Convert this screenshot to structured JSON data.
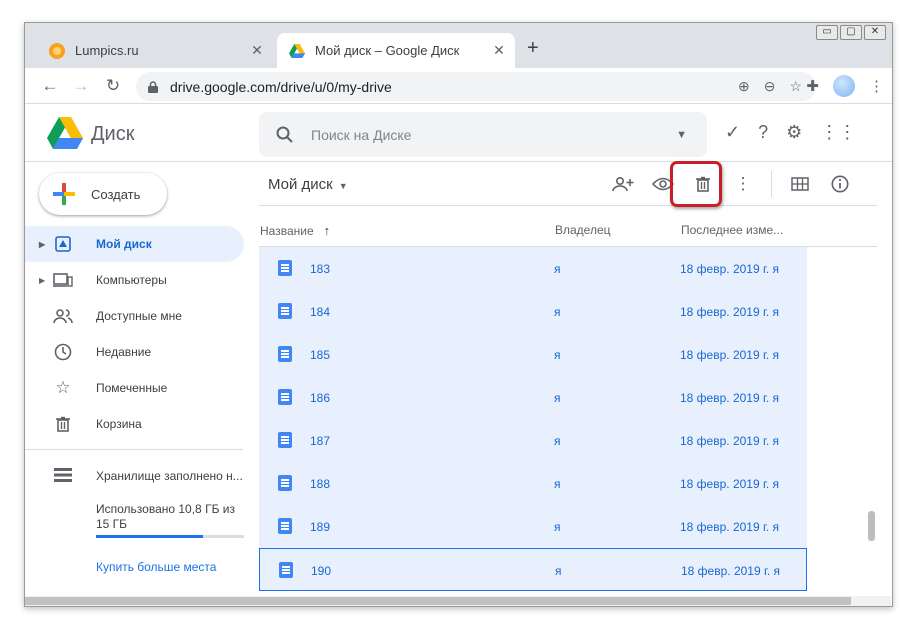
{
  "browser": {
    "tabs": [
      {
        "title": "Lumpics.ru",
        "close": "✕"
      },
      {
        "title": "Мой диск – Google Диск",
        "close": "✕"
      }
    ],
    "new_tab": "+",
    "url": "drive.google.com/drive/u/0/my-drive",
    "window_controls": [
      "▭",
      "▢",
      "✕"
    ]
  },
  "app": {
    "name": "Диск",
    "search_placeholder": "Поиск на Диске"
  },
  "sidebar": {
    "create_label": "Создать",
    "items": [
      {
        "label": "Мой диск",
        "icon": "my-drive-icon",
        "active": true
      },
      {
        "label": "Компьютеры",
        "icon": "computers-icon"
      },
      {
        "label": "Доступные мне",
        "icon": "shared-icon"
      },
      {
        "label": "Недавние",
        "icon": "recent-icon"
      },
      {
        "label": "Помеченные",
        "icon": "starred-icon"
      },
      {
        "label": "Корзина",
        "icon": "trash-icon"
      }
    ],
    "storage": {
      "title": "Хранилище заполнено н...",
      "used": "Использовано 10,8 ГБ из 15 ГБ",
      "fraction": 0.72,
      "buy": "Купить больше места"
    }
  },
  "main": {
    "breadcrumb": "Мой диск",
    "columns": {
      "name": "Название",
      "owner": "Владелец",
      "modified": "Последнее изме..."
    },
    "rows": [
      {
        "name": "183",
        "owner": "я",
        "date": "18 февр. 2019 г. я"
      },
      {
        "name": "184",
        "owner": "я",
        "date": "18 февр. 2019 г. я"
      },
      {
        "name": "185",
        "owner": "я",
        "date": "18 февр. 2019 г. я"
      },
      {
        "name": "186",
        "owner": "я",
        "date": "18 февр. 2019 г. я"
      },
      {
        "name": "187",
        "owner": "я",
        "date": "18 февр. 2019 г. я"
      },
      {
        "name": "188",
        "owner": "я",
        "date": "18 февр. 2019 г. я"
      },
      {
        "name": "189",
        "owner": "я",
        "date": "18 февр. 2019 г. я"
      },
      {
        "name": "190",
        "owner": "я",
        "date": "18 февр. 2019 г. я"
      }
    ]
  },
  "colors": {
    "accent": "#1a73e8",
    "selection": "#e8f0fe",
    "highlight_box": "#c8202b"
  }
}
